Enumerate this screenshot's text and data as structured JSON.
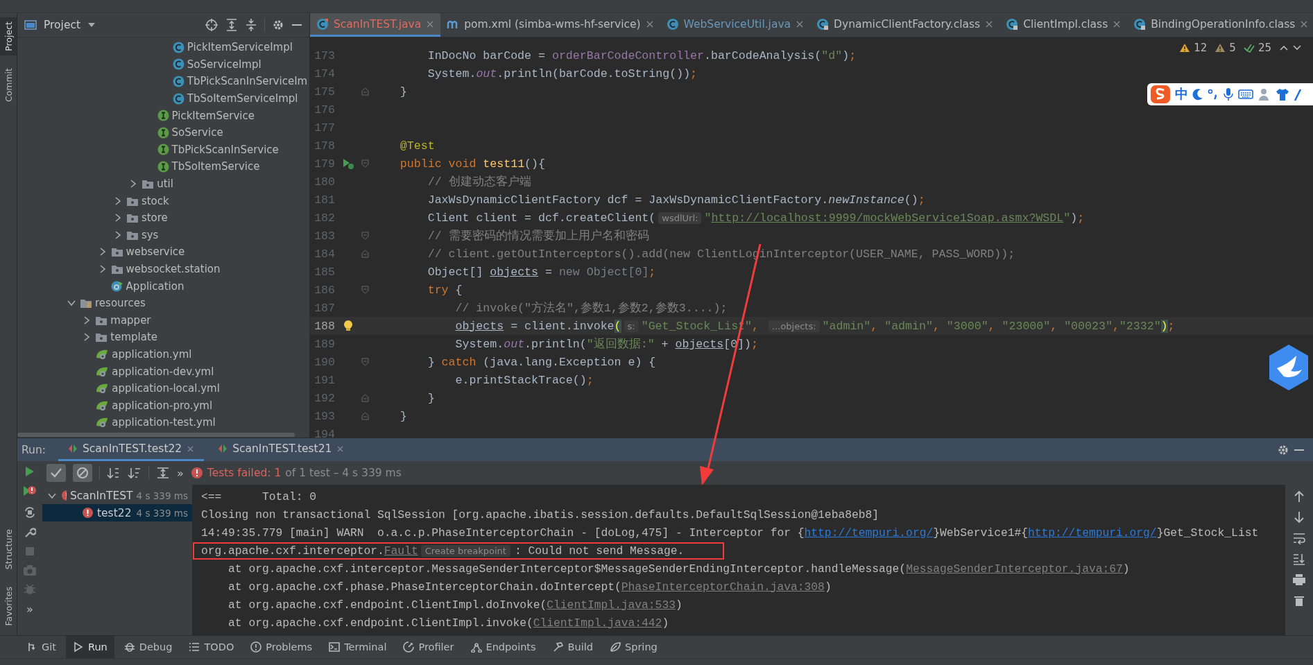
{
  "side_strip": {
    "top": [
      {
        "label": "Project",
        "selected": true
      },
      {
        "label": "Commit",
        "selected": false
      }
    ],
    "bottom": [
      {
        "label": "Structure",
        "selected": false
      },
      {
        "label": "Favorites",
        "selected": false
      }
    ]
  },
  "project_panel": {
    "title": "Project"
  },
  "project_tree": [
    {
      "children": [
        {
          "children": [
            {
              "children": [
                {
                  "children": [
                    {
                      "children": [
                        {
                          "children": [
                            {
                              "label": "PickItemServiceImpl",
                              "kind": "class"
                            },
                            {
                              "label": "SoServiceImpl",
                              "kind": "class"
                            },
                            {
                              "label": "TbPickScanInServiceIm",
                              "kind": "class"
                            },
                            {
                              "label": "TbSoItemServiceImpl",
                              "kind": "class"
                            }
                          ]
                        },
                        {
                          "label": "PickItemService",
                          "kind": "interface"
                        },
                        {
                          "label": "SoService",
                          "kind": "interface"
                        },
                        {
                          "label": "TbPickScanInService",
                          "kind": "interface"
                        },
                        {
                          "label": "TbSoItemService",
                          "kind": "interface"
                        }
                      ]
                    },
                    {
                      "label": "util",
                      "kind": "folder",
                      "expanded": false
                    }
                  ]
                },
                {
                  "label": "stock",
                  "kind": "folder",
                  "expanded": false
                },
                {
                  "label": "store",
                  "kind": "folder",
                  "expanded": false
                },
                {
                  "label": "sys",
                  "kind": "folder",
                  "expanded": false
                }
              ]
            },
            {
              "label": "webservice",
              "kind": "folder",
              "expanded": false
            },
            {
              "label": "websocket.station",
              "kind": "folder",
              "expanded": false
            },
            {
              "label": "Application",
              "kind": "app"
            }
          ]
        }
      ]
    },
    {
      "label": "resources",
      "kind": "resources",
      "expanded": true,
      "children": [
        {
          "label": "mapper",
          "kind": "folder",
          "expanded": false
        },
        {
          "label": "template",
          "kind": "folder",
          "expanded": false
        },
        {
          "label": "application.yml",
          "kind": "yaml"
        },
        {
          "label": "application-dev.yml",
          "kind": "yaml"
        },
        {
          "label": "application-local.yml",
          "kind": "yaml"
        },
        {
          "label": "application-pro.yml",
          "kind": "yaml"
        },
        {
          "label": "application-test.yml",
          "kind": "yaml"
        }
      ]
    }
  ],
  "editor_tabs": [
    {
      "label": "ScanInTEST.java",
      "kind": "java",
      "error": true,
      "modified": false,
      "selected": true
    },
    {
      "label": "pom.xml (simba-wms-hf-service)",
      "kind": "maven",
      "error": false,
      "modified": false,
      "selected": false
    },
    {
      "label": "WebServiceUtil.java",
      "kind": "java",
      "error": false,
      "modified": true,
      "selected": false
    },
    {
      "label": "DynamicClientFactory.class",
      "kind": "class",
      "error": false,
      "modified": false,
      "selected": false
    },
    {
      "label": "ClientImpl.class",
      "kind": "class",
      "error": false,
      "modified": false,
      "selected": false
    },
    {
      "label": "BindingOperationInfo.class",
      "kind": "class",
      "error": false,
      "modified": false,
      "selected": false
    }
  ],
  "inspections": {
    "warnings": "12",
    "weak_warnings": "5",
    "typos": "25"
  },
  "code_lines": [
    {
      "number": "173",
      "current": false,
      "tokens": [
        {
          "kind": "plain",
          "text": "        InDocNo barCode = "
        },
        {
          "kind": "field",
          "text": "orderBarCodeController"
        },
        {
          "kind": "plain",
          "text": ".barCodeAnalysis("
        },
        {
          "kind": "string",
          "text": "\"d\""
        },
        {
          "kind": "plain",
          "text": ")"
        },
        {
          "kind": "keyword",
          "text": ";"
        }
      ]
    },
    {
      "number": "174",
      "current": false,
      "tokens": [
        {
          "kind": "plain",
          "text": "        System."
        },
        {
          "kind": "static",
          "text": "out"
        },
        {
          "kind": "plain",
          "text": ".println(barCode.toString())"
        },
        {
          "kind": "keyword",
          "text": ";"
        }
      ]
    },
    {
      "number": "175",
      "current": false,
      "fold": {
        "kind": "end"
      },
      "tokens": [
        {
          "kind": "plain",
          "text": "    }"
        }
      ]
    },
    {
      "number": "176",
      "current": false
    },
    {
      "number": "177",
      "current": false
    },
    {
      "number": "178",
      "current": false,
      "tokens": [
        {
          "kind": "annotation",
          "text": "    @Test"
        }
      ]
    },
    {
      "number": "179",
      "current": false,
      "fold": {
        "kind": "start"
      },
      "gutter_icon": {
        "kind": "run-test"
      },
      "tokens": [
        {
          "kind": "keyword",
          "text": "    public void "
        },
        {
          "kind": "method",
          "text": "test11"
        },
        {
          "kind": "plain",
          "text": "(){"
        }
      ]
    },
    {
      "number": "180",
      "current": false,
      "tokens": [
        {
          "kind": "comment",
          "text": "        // 创建动态客户端"
        }
      ]
    },
    {
      "number": "181",
      "current": false,
      "tokens": [
        {
          "kind": "plain",
          "text": "        JaxWsDynamicClientFactory dcf = JaxWsDynamicClientFactory."
        },
        {
          "kind": "italic",
          "text": "newInstance"
        },
        {
          "kind": "plain",
          "text": "()"
        },
        {
          "kind": "keyword",
          "text": ";"
        }
      ]
    },
    {
      "number": "182",
      "current": false,
      "tokens": [
        {
          "kind": "plain",
          "text": "        Client client = dcf.createClient("
        },
        {
          "kind": "hint",
          "text": "wsdlUrl:"
        },
        {
          "kind": "string",
          "text": "\""
        },
        {
          "kind": "url",
          "text": "http://localhost:9999/mockWebService1Soap.asmx?WSDL"
        },
        {
          "kind": "string",
          "text": "\""
        },
        {
          "kind": "plain",
          "text": ")"
        },
        {
          "kind": "keyword",
          "text": ";"
        }
      ]
    },
    {
      "number": "183",
      "current": false,
      "fold": {
        "kind": "start"
      },
      "tokens": [
        {
          "kind": "comment",
          "text": "        // 需要密码的情况需要加上用户名和密码"
        }
      ]
    },
    {
      "number": "184",
      "current": false,
      "fold": {
        "kind": "end"
      },
      "tokens": [
        {
          "kind": "comment",
          "text": "        // client.getOutInterceptors().add(new ClientLoginInterceptor(USER_NAME, PASS_WORD));"
        }
      ]
    },
    {
      "number": "185",
      "current": false,
      "tokens": [
        {
          "kind": "plain",
          "text": "        Object[] "
        },
        {
          "kind": "var",
          "text": "objects"
        },
        {
          "kind": "plain",
          "text": " = "
        },
        {
          "kind": "unused",
          "text": "new Object[0]"
        },
        {
          "kind": "keyword",
          "text": ";"
        }
      ]
    },
    {
      "number": "186",
      "current": false,
      "fold": {
        "kind": "start"
      },
      "tokens": [
        {
          "kind": "keyword",
          "text": "        try"
        },
        {
          "kind": "plain",
          "text": " {"
        }
      ]
    },
    {
      "number": "187",
      "current": false,
      "tokens": [
        {
          "kind": "comment",
          "text": "            // invoke(\"方法名\",参数1,参数2,参数3....);"
        }
      ]
    },
    {
      "number": "188",
      "current": true,
      "gutter_icon": {
        "kind": "intention"
      },
      "tokens": [
        {
          "kind": "var",
          "text": "            objects"
        },
        {
          "kind": "plain",
          "text": " = client.invoke"
        },
        {
          "kind": "brace",
          "text": "("
        },
        {
          "kind": "hint",
          "text": "s:"
        },
        {
          "kind": "string",
          "text": "\"Get_Stock_List\""
        },
        {
          "kind": "keyword",
          "text": ", "
        },
        {
          "kind": "hint",
          "text": "...objects:"
        },
        {
          "kind": "string",
          "text": "\"admin\""
        },
        {
          "kind": "keyword",
          "text": ", "
        },
        {
          "kind": "string",
          "text": "\"admin\""
        },
        {
          "kind": "keyword",
          "text": ", "
        },
        {
          "kind": "string",
          "text": "\"3000\""
        },
        {
          "kind": "keyword",
          "text": ", "
        },
        {
          "kind": "string",
          "text": "\"23000\""
        },
        {
          "kind": "keyword",
          "text": ", "
        },
        {
          "kind": "string",
          "text": "\"00023\""
        },
        {
          "kind": "keyword",
          "text": ","
        },
        {
          "kind": "string",
          "text": "\"2332\""
        },
        {
          "kind": "brace",
          "text": ")"
        },
        {
          "kind": "keyword",
          "text": ";"
        }
      ]
    },
    {
      "number": "189",
      "current": false,
      "tokens": [
        {
          "kind": "plain",
          "text": "            System."
        },
        {
          "kind": "static",
          "text": "out"
        },
        {
          "kind": "plain",
          "text": ".println("
        },
        {
          "kind": "string",
          "text": "\"返回数据:\""
        },
        {
          "kind": "plain",
          "text": " + "
        },
        {
          "kind": "var",
          "text": "objects"
        },
        {
          "kind": "plain",
          "text": "[0])"
        },
        {
          "kind": "keyword",
          "text": ";"
        }
      ]
    },
    {
      "number": "190",
      "current": false,
      "fold": {
        "kind": "start"
      },
      "tokens": [
        {
          "kind": "plain",
          "text": "        } "
        },
        {
          "kind": "keyword",
          "text": "catch"
        },
        {
          "kind": "plain",
          "text": " (java.lang.Exception e) {"
        }
      ]
    },
    {
      "number": "191",
      "current": false,
      "tokens": [
        {
          "kind": "plain",
          "text": "            e.printStackTrace()"
        },
        {
          "kind": "keyword",
          "text": ";"
        }
      ]
    },
    {
      "number": "192",
      "current": false,
      "fold": {
        "kind": "end"
      },
      "tokens": [
        {
          "kind": "plain",
          "text": "        }"
        }
      ]
    },
    {
      "number": "193",
      "current": false,
      "fold": {
        "kind": "end"
      },
      "tokens": [
        {
          "kind": "plain",
          "text": "    }"
        }
      ]
    },
    {
      "number": "194",
      "current": false
    }
  ],
  "ime_toolbar": {
    "mode": "中"
  },
  "run_panel": {
    "label": "Run:",
    "tabs": [
      {
        "label": "ScanInTEST.test22",
        "selected": true
      },
      {
        "label": "ScanInTEST.test21",
        "selected": false
      }
    ],
    "toggles": [
      {
        "on": true
      },
      {
        "on": true
      }
    ],
    "more": "»",
    "side_more": "»",
    "status_failed": "Tests failed: 1",
    "status_detail": "of 1 test – 4 s 339 ms",
    "tests": [
      {
        "label": "ScanInTEST",
        "time": "4 s 339 ms",
        "failed": true,
        "expanded": true,
        "selected": false,
        "children": [
          {
            "label": "test22",
            "time": "4 s 339 ms",
            "failed": true,
            "selected": true
          }
        ]
      }
    ],
    "console": [
      {
        "boxed": false,
        "tokens": [
          {
            "kind": "text",
            "text": "<==      Total: 0"
          }
        ]
      },
      {
        "boxed": false,
        "tokens": [
          {
            "kind": "text",
            "text": "Closing non transactional SqlSession [org.apache.ibatis.session.defaults.DefaultSqlSession@1eba8eb8]"
          }
        ]
      },
      {
        "boxed": false,
        "tokens": [
          {
            "kind": "text",
            "text": "14:49:35.779 [main] WARN  o.a.c.p.PhaseInterceptorChain - [doLog,475] - Interceptor for {"
          },
          {
            "kind": "link",
            "text": "http://tempuri.org/"
          },
          {
            "kind": "text",
            "text": "}WebService1#{"
          },
          {
            "kind": "link",
            "text": "http://tempuri.org/"
          },
          {
            "kind": "text",
            "text": "}Get_Stock_List"
          }
        ]
      },
      {
        "boxed": true,
        "tokens": [
          {
            "kind": "text",
            "text": "org.apache.cxf.interceptor."
          },
          {
            "kind": "source",
            "text": "Fault"
          },
          {
            "kind": "hint",
            "text": "Create breakpoint"
          },
          {
            "kind": "text",
            "text": ": Could not send Message."
          }
        ]
      },
      {
        "boxed": false,
        "tokens": [
          {
            "kind": "text",
            "text": "    at org.apache.cxf.interceptor.MessageSenderInterceptor$MessageSenderEndingInterceptor.handleMessage("
          },
          {
            "kind": "source",
            "text": "MessageSenderInterceptor.java:67"
          },
          {
            "kind": "text",
            "text": ")"
          }
        ]
      },
      {
        "boxed": false,
        "tokens": [
          {
            "kind": "text",
            "text": "    at org.apache.cxf.phase.PhaseInterceptorChain.doIntercept("
          },
          {
            "kind": "source",
            "text": "PhaseInterceptorChain.java:308"
          },
          {
            "kind": "text",
            "text": ")"
          }
        ]
      },
      {
        "boxed": false,
        "tokens": [
          {
            "kind": "text",
            "text": "    at org.apache.cxf.endpoint.ClientImpl.doInvoke("
          },
          {
            "kind": "source",
            "text": "ClientImpl.java:533"
          },
          {
            "kind": "text",
            "text": ")"
          }
        ]
      },
      {
        "boxed": false,
        "tokens": [
          {
            "kind": "text",
            "text": "    at org.apache.cxf.endpoint.ClientImpl.invoke("
          },
          {
            "kind": "source",
            "text": "ClientImpl.java:442"
          },
          {
            "kind": "text",
            "text": ")"
          }
        ]
      }
    ]
  },
  "tool_windows": [
    {
      "label": "Git",
      "selected": false
    },
    {
      "label": "Run",
      "selected": true
    },
    {
      "label": "Debug",
      "selected": false
    },
    {
      "label": "TODO",
      "selected": false
    },
    {
      "label": "Problems",
      "selected": false
    },
    {
      "label": "Terminal",
      "selected": false
    },
    {
      "label": "Profiler",
      "selected": false
    },
    {
      "label": "Endpoints",
      "selected": false
    },
    {
      "label": "Build",
      "selected": false
    },
    {
      "label": "Spring",
      "selected": false
    }
  ]
}
